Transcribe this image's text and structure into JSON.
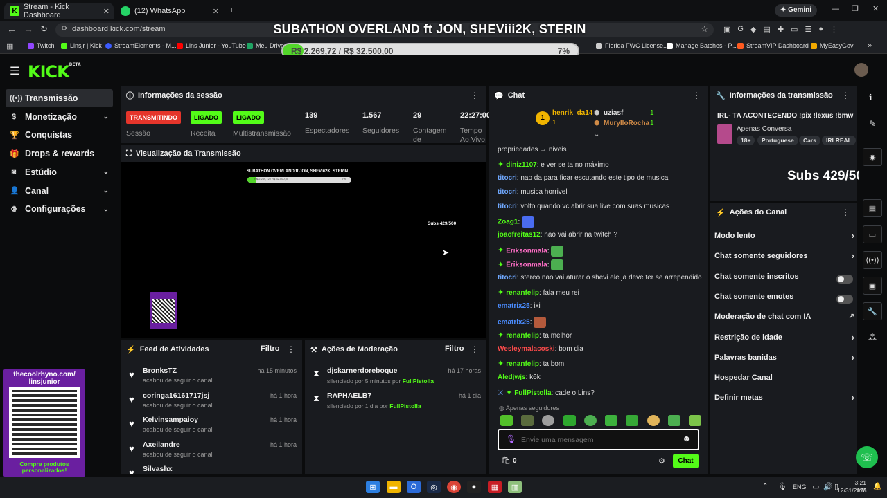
{
  "browser": {
    "tabs": [
      {
        "title": "Stream - Kick Dashboard",
        "active": true
      },
      {
        "title": "(12) WhatsApp",
        "active": false
      }
    ],
    "gemini": "Gemini",
    "url": "dashboard.kick.com/stream",
    "bookmarks": [
      "Twitch",
      "Linsjr | Kick",
      "StreamElements - M...",
      "Lins Junior - YouTube",
      "Meu Drive",
      "Florida FWC License...",
      "Manage Batches - P...",
      "StreamVIP Dashboard",
      "MyEasyGov"
    ]
  },
  "overlay": {
    "title": "SUBATHON OVERLAND ft JON, SHEViii2K, STERIN",
    "amount": "R$ 2.269,72 / R$ 32.500,00",
    "percent_label": "7%",
    "progress": 0.07,
    "subs": "Subs 429/500",
    "qr_caption": "thecoolrhyno.com/ linsjunior",
    "qr_footer": "Compre produtos personalizados!"
  },
  "kick": {
    "logo": "KICK",
    "beta": "BETA"
  },
  "sidebar": [
    {
      "label": "Transmissão",
      "icon": "broadcast-icon",
      "chev": false,
      "active": true
    },
    {
      "label": "Monetização",
      "icon": "dollar-icon",
      "chev": true
    },
    {
      "label": "Conquistas",
      "icon": "trophy-icon",
      "chev": false
    },
    {
      "label": "Drops & rewards",
      "icon": "gift-icon",
      "chev": false
    },
    {
      "label": "Estúdio",
      "icon": "studio-icon",
      "chev": true
    },
    {
      "label": "Canal",
      "icon": "user-icon",
      "chev": true
    },
    {
      "label": "Configurações",
      "icon": "gear-icon",
      "chev": true
    }
  ],
  "session": {
    "title": "Informações da sessão",
    "badges": {
      "live": "TRANSMITINDO",
      "on1": "LIGADO",
      "on2": "LIGADO"
    },
    "labels": {
      "session": "Sessão",
      "revenue": "Receita",
      "multi": "Multistransmissão"
    },
    "stats": [
      {
        "value": "139",
        "label": "Espectadores"
      },
      {
        "value": "1.567",
        "label": "Seguidores"
      },
      {
        "value": "29",
        "label": "Contagem de"
      },
      {
        "value": "22:27:00",
        "label": "Tempo Ao Vivo"
      }
    ],
    "colors": {
      "live": "#e5352b",
      "on": "#53fc18"
    }
  },
  "preview": {
    "title": "Visualização da Transmissão"
  },
  "feed": {
    "title": "Feed de Atividades",
    "filter": "Filtro",
    "items": [
      {
        "name": "BronksTZ",
        "action": "acabou de seguir o canal",
        "time": "há 15 minutos"
      },
      {
        "name": "coringa16161717jsj",
        "action": "acabou de seguir o canal",
        "time": "há 1 hora"
      },
      {
        "name": "Kelvinsampaioy",
        "action": "acabou de seguir o canal",
        "time": "há 1 hora"
      },
      {
        "name": "Axeilandre",
        "action": "acabou de seguir o canal",
        "time": "há 1 hora"
      },
      {
        "name": "Silvashx",
        "action": "",
        "time": ""
      }
    ]
  },
  "moderation": {
    "title": "Ações de Moderação",
    "filter": "Filtro",
    "items": [
      {
        "name": "djskarnerdoreboque",
        "detail": "silenciado por 5 minutos por",
        "by": "FullPistolla",
        "time": "há 17 horas"
      },
      {
        "name": "RAPHAELB7",
        "detail": "silenciado por 1 dia por",
        "by": "FullPistolla",
        "time": "há 1 dia"
      }
    ]
  },
  "chat": {
    "title": "Chat",
    "leaders": [
      {
        "name": "henrik_da14",
        "count": "1"
      },
      {
        "name": "uziasf",
        "count": "1"
      },
      {
        "name": "MuryIloRocha",
        "count": "1"
      }
    ],
    "partial": "propriedades → niveis",
    "messages": [
      {
        "user": "diniz1107",
        "text": "e ver se ta no máximo",
        "color": "#53fc18",
        "gem": true
      },
      {
        "user": "titocri",
        "text": "nao da para ficar escutando este tipo de musica",
        "color": "#6fa8ff",
        "gem": false
      },
      {
        "user": "titocri",
        "text": "musica horrivel",
        "color": "#6fa8ff",
        "gem": false
      },
      {
        "user": "titocri",
        "text": "volto quando vc abrir sua live com suas musicas",
        "color": "#6fa8ff",
        "gem": false
      },
      {
        "user": "Zoag1",
        "text": "",
        "color": "#53fc18",
        "gem": false,
        "emote": "#4a6cf0"
      },
      {
        "user": "joaofreitas12",
        "text": "nao vai abrir na twitch ?",
        "color": "#53fc18",
        "gem": false
      },
      {
        "user": "Eriksonmala",
        "text": "",
        "color": "#ff6ec7",
        "gem": true,
        "emote": "#4caf50"
      },
      {
        "user": "Eriksonmala",
        "text": "",
        "color": "#ff6ec7",
        "gem": true,
        "emote": "#4caf50"
      },
      {
        "user": "titocri",
        "text": "stereo nao vai aturar o shevi ele ja deve ter se arrependido",
        "color": "#6fa8ff",
        "gem": false
      },
      {
        "user": "renanfelip",
        "text": "fala meu rei",
        "color": "#53fc18",
        "gem": true
      },
      {
        "user": "ematrix25",
        "text": "ixi",
        "color": "#4a8cff",
        "gem": false
      },
      {
        "user": "ematrix25",
        "text": "",
        "color": "#4a8cff",
        "gem": false,
        "emote": "#b45a3c"
      },
      {
        "user": "renanfelip",
        "text": "ta melhor",
        "color": "#53fc18",
        "gem": true
      },
      {
        "user": "Wesleymalacoski",
        "text": "bom dia",
        "color": "#ff4b4b",
        "gem": false
      },
      {
        "user": "renanfelip",
        "text": "ta bom",
        "color": "#53fc18",
        "gem": true
      },
      {
        "user": "Aledjwjs",
        "text": "k6k",
        "color": "#53fc18",
        "gem": false
      },
      {
        "user": "FullPistolla",
        "text": "cade o Lins?",
        "color": "#53fc18",
        "gem": true
      }
    ],
    "followers_only": "Apenas seguidores",
    "placeholder": "Envie uma mensagem",
    "points": "0",
    "send": "Chat"
  },
  "stream_info": {
    "title": "Informações da transmissão",
    "stream_title": "IRL- TA ACONTECENDO !pix !lexus !bmw",
    "category": "Apenas Conversa",
    "tags": [
      "18+",
      "Portuguese",
      "Cars",
      "IRLREAL"
    ]
  },
  "channel_actions": {
    "title": "Ações do Canal",
    "items": [
      {
        "label": "Modo lento",
        "kind": "chevron"
      },
      {
        "label": "Chat somente seguidores",
        "kind": "chevron"
      },
      {
        "label": "Chat somente inscritos",
        "kind": "toggle"
      },
      {
        "label": "Chat somente emotes",
        "kind": "toggle"
      },
      {
        "label": "Moderação de chat com IA",
        "kind": "external"
      },
      {
        "label": "Restrição de idade",
        "kind": "chevron"
      },
      {
        "label": "Palavras banidas",
        "kind": "chevron"
      },
      {
        "label": "Hospedar Canal",
        "kind": "none"
      },
      {
        "label": "Definir metas",
        "kind": "chevron"
      }
    ]
  },
  "taskbar": {
    "lang": "ENG",
    "time": "3:21 PM",
    "date": "12/31/2025"
  }
}
